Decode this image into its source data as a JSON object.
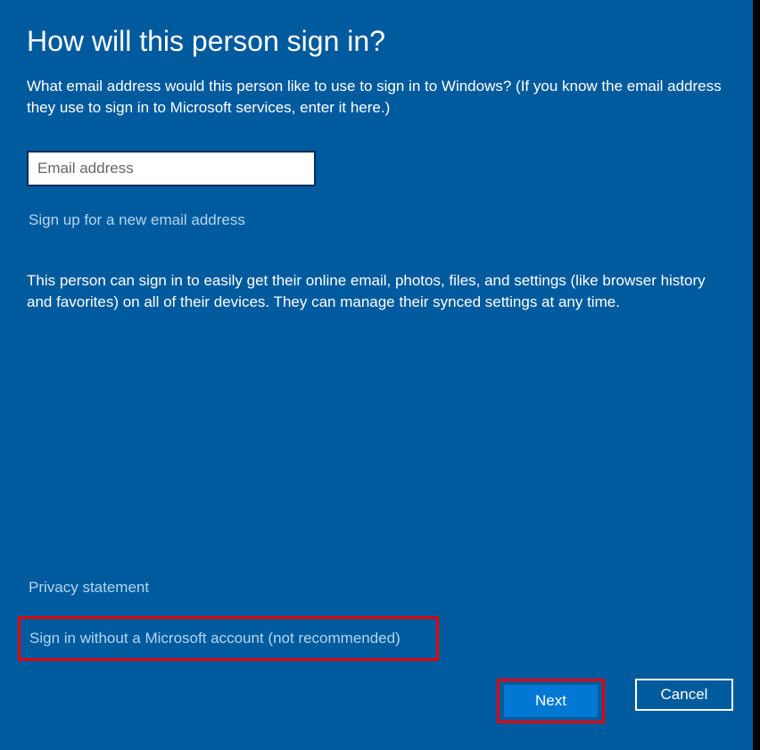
{
  "title": "How will this person sign in?",
  "description": "What email address would this person like to use to sign in to Windows? (If you know the email address they use to sign in to Microsoft services, enter it here.)",
  "email": {
    "placeholder": "Email address",
    "value": ""
  },
  "signup_link": "Sign up for a new email address",
  "info_text": "This person can sign in to easily get their online email, photos, files, and settings (like browser history and favorites) on all of their devices. They can manage their synced settings at any time.",
  "privacy_link": "Privacy statement",
  "no_account_link": "Sign in without a Microsoft account (not recommended)",
  "buttons": {
    "next": "Next",
    "cancel": "Cancel"
  }
}
